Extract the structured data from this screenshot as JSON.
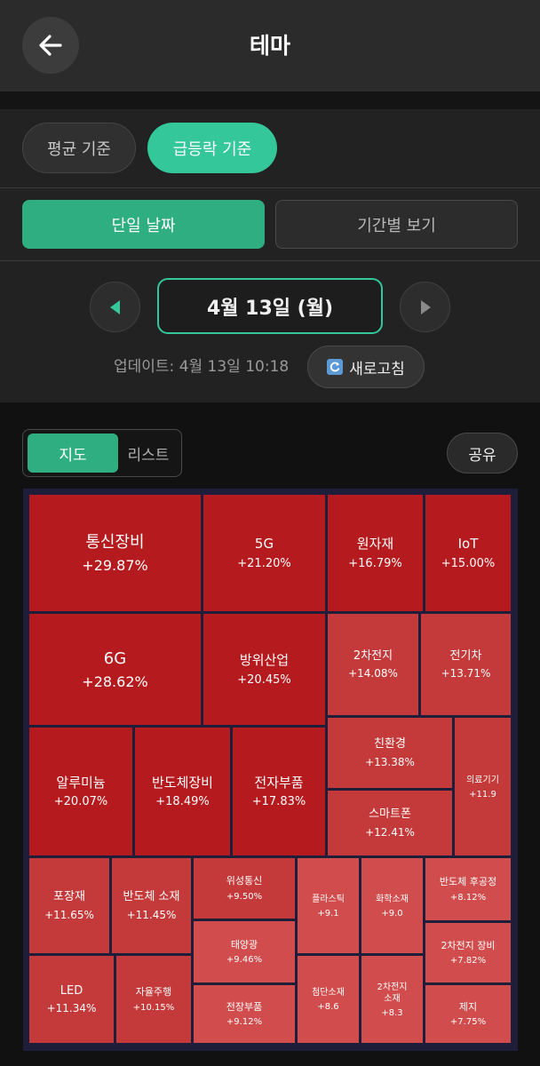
{
  "header": {
    "title": "테마",
    "back_icon": "arrow-left-icon"
  },
  "filters": {
    "basis": [
      {
        "label": "평균 기준",
        "selected": false
      },
      {
        "label": "급등락 기준",
        "selected": true
      }
    ],
    "range": [
      {
        "label": "단일 날짜",
        "selected": true
      },
      {
        "label": "기간별 보기",
        "selected": false
      }
    ]
  },
  "date_nav": {
    "current": "4월 13일 (월)",
    "prev_icon": "triangle-left-icon",
    "next_icon": "triangle-right-icon"
  },
  "update": {
    "text": "업데이트: 4월 13일 10:18",
    "refresh_label": "새로고침",
    "refresh_icon": "refresh-icon"
  },
  "view": {
    "map_label": "지도",
    "list_label": "리스트",
    "selected": "map",
    "share_label": "공유"
  },
  "colors": {
    "accent": "#34c79a",
    "strong_red": "#b51b1e",
    "mid_red": "#c4393a",
    "light_red": "#d14c4d"
  },
  "treemap": [
    {
      "name": "통신장비",
      "change": "+29.87%"
    },
    {
      "name": "5G",
      "change": "+21.20%"
    },
    {
      "name": "원자재",
      "change": "+16.79%"
    },
    {
      "name": "IoT",
      "change": "+15.00%"
    },
    {
      "name": "6G",
      "change": "+28.62%"
    },
    {
      "name": "방위산업",
      "change": "+20.45%"
    },
    {
      "name": "2차전지",
      "change": "+14.08%"
    },
    {
      "name": "전기차",
      "change": "+13.71%"
    },
    {
      "name": "알루미늄",
      "change": "+20.07%"
    },
    {
      "name": "반도체장비",
      "change": "+18.49%"
    },
    {
      "name": "전자부품",
      "change": "+17.83%"
    },
    {
      "name": "친환경",
      "change": "+13.38%"
    },
    {
      "name": "의료기기",
      "change": "+11.9"
    },
    {
      "name": "스마트폰",
      "change": "+12.41%"
    },
    {
      "name": "포장재",
      "change": "+11.65%"
    },
    {
      "name": "반도체 소재",
      "change": "+11.45%"
    },
    {
      "name": "위성통신",
      "change": "+9.50%"
    },
    {
      "name": "플라스틱",
      "change": "+9.1"
    },
    {
      "name": "화학소재",
      "change": "+9.0"
    },
    {
      "name": "반도체 후공정",
      "change": "+8.12%"
    },
    {
      "name": "태양광",
      "change": "+9.46%"
    },
    {
      "name": "2차전지 장비",
      "change": "+7.82%"
    },
    {
      "name": "LED",
      "change": "+11.34%"
    },
    {
      "name": "자율주행",
      "change": "+10.15%"
    },
    {
      "name": "전장부품",
      "change": "+9.12%"
    },
    {
      "name": "첨단소재",
      "change": "+8.6"
    },
    {
      "name": "2차전지\n소재",
      "change": "+8.3"
    },
    {
      "name": "제지",
      "change": "+7.75%"
    }
  ]
}
